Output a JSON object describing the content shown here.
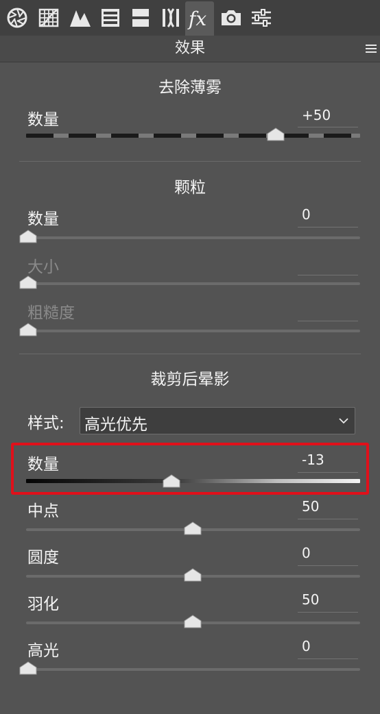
{
  "toolbar": {
    "tools": [
      {
        "icon": "aperture-icon"
      },
      {
        "icon": "grid-icon"
      },
      {
        "icon": "mountains-icon"
      },
      {
        "icon": "hsl-bars-icon"
      },
      {
        "icon": "split-toning-icon"
      },
      {
        "icon": "lens-icon"
      },
      {
        "icon": "fx-icon",
        "active": true
      },
      {
        "icon": "camera-icon"
      },
      {
        "icon": "sliders-icon"
      }
    ]
  },
  "panel": {
    "title": "效果",
    "menu_icon": "menu-icon"
  },
  "dehaze": {
    "title": "去除薄雾",
    "amount": {
      "label": "数量",
      "value": "+50",
      "level": 0.75
    }
  },
  "grain": {
    "title": "颗粒",
    "amount": {
      "label": "数量",
      "value": "0",
      "level": 0.0
    },
    "size": {
      "label": "大小",
      "value": "",
      "level": 0.0,
      "disabled": true
    },
    "roughness": {
      "label": "粗糙度",
      "value": "",
      "level": 0.0,
      "disabled": true
    }
  },
  "vignette": {
    "title": "裁剪后晕影",
    "style": {
      "label": "样式:",
      "selected": "高光优先"
    },
    "amount": {
      "label": "数量",
      "value": "-13",
      "level": 0.435
    },
    "midpoint": {
      "label": "中点",
      "value": "50",
      "level": 0.5
    },
    "roundness": {
      "label": "圆度",
      "value": "0",
      "level": 0.5
    },
    "feather": {
      "label": "羽化",
      "value": "50",
      "level": 0.5
    },
    "highlights": {
      "label": "高光",
      "value": "0",
      "level": 0.0
    }
  },
  "colors": {
    "highlight_box": "#e0101a",
    "panel_bg": "#535353",
    "toolbar_bg": "#404040"
  }
}
